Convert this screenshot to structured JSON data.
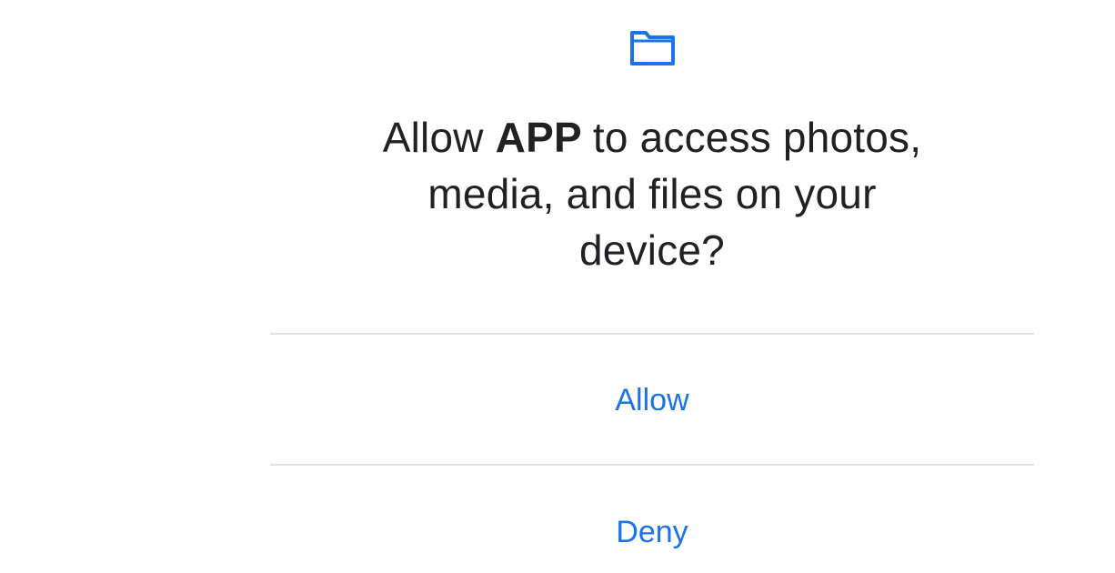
{
  "dialog": {
    "icon": "folder-icon",
    "prompt": {
      "line1_before": "Allow ",
      "app_name": "APP",
      "line1_after": "to access photos,",
      "line2": "media, and files on your",
      "line3": "device?"
    },
    "actions": {
      "allow_label": "Allow",
      "deny_label": "Deny"
    }
  },
  "colors": {
    "accent": "#1a73e8",
    "text": "#202124",
    "divider": "#e0e0e0",
    "background": "#ffffff"
  }
}
